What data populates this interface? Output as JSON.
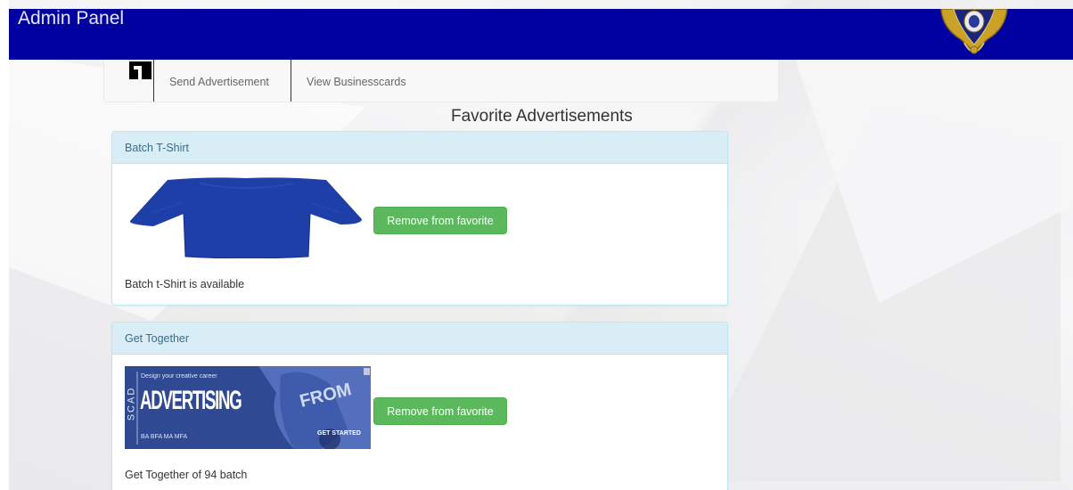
{
  "header": {
    "title": "Admin Panel",
    "bg_color": "#0000a0",
    "emblem_icon": "crest-emblem-icon"
  },
  "nav": {
    "logo_icon": "brand-logo-icon",
    "links": [
      {
        "label": "Send Advertisement"
      },
      {
        "label": "View Businesscards"
      }
    ]
  },
  "page": {
    "title": "Favorite Advertisements"
  },
  "advertisements": [
    {
      "heading": "Batch T-Shirt",
      "image": "blue-tshirt-image",
      "button_label": "Remove from favorite",
      "description": "Batch t-Shirt is available"
    },
    {
      "heading": "Get Together",
      "image": "scad-advertising-banner-image",
      "image_text": {
        "vertical": "SCAD",
        "line1": "Design your creative career",
        "headline": "ADVERTISING",
        "degrees": "BA  BFA  MA  MFA",
        "cta": "GET STARTED",
        "side": "FROM"
      },
      "button_label": "Remove from favorite",
      "description": "Get Together of 94 batch"
    }
  ],
  "colors": {
    "panel_heading_bg": "#d9edf7",
    "panel_border": "#bce8f1",
    "heading_text": "#31708f",
    "button_green": "#5cb85c"
  }
}
